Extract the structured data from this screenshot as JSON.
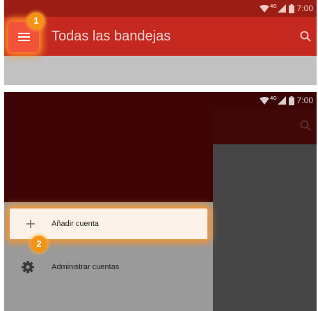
{
  "status": {
    "network": "4G",
    "time": "7:00"
  },
  "screen1": {
    "title": "Todas las bandejas",
    "step_badge": "1"
  },
  "screen2": {
    "step_badge": "2",
    "drawer": {
      "items": [
        {
          "label": "Añadir cuenta",
          "icon": "plus-icon"
        },
        {
          "label": "Administrar cuentas",
          "icon": "gear-icon"
        }
      ]
    }
  },
  "colors": {
    "appbar": "#c5281f",
    "statusbar": "#9c1d15",
    "highlight": "#f59315"
  }
}
